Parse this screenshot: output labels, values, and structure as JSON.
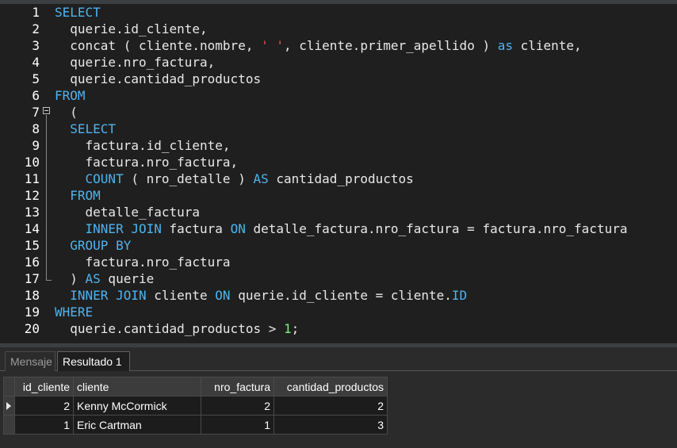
{
  "editor": {
    "line_numbers": [
      "1",
      "2",
      "3",
      "4",
      "5",
      "6",
      "7",
      "8",
      "9",
      "10",
      "11",
      "12",
      "13",
      "14",
      "15",
      "16",
      "17",
      "18",
      "19",
      "20"
    ],
    "lines": [
      [
        {
          "t": "SELECT",
          "c": "kw"
        }
      ],
      [
        {
          "t": "  querie.id_cliente,",
          "c": ""
        }
      ],
      [
        {
          "t": "  concat ( cliente.nombre, ",
          "c": ""
        },
        {
          "t": "' '",
          "c": "str"
        },
        {
          "t": ", cliente.primer_apellido ) ",
          "c": ""
        },
        {
          "t": "as",
          "c": "kw"
        },
        {
          "t": " cliente,",
          "c": ""
        }
      ],
      [
        {
          "t": "  querie.nro_factura,",
          "c": ""
        }
      ],
      [
        {
          "t": "  querie.cantidad_productos",
          "c": ""
        }
      ],
      [
        {
          "t": "FROM",
          "c": "kw"
        }
      ],
      [
        {
          "t": "  (",
          "c": ""
        }
      ],
      [
        {
          "t": "  ",
          "c": ""
        },
        {
          "t": "SELECT",
          "c": "kw"
        }
      ],
      [
        {
          "t": "    factura.id_cliente,",
          "c": ""
        }
      ],
      [
        {
          "t": "    factura.nro_factura,",
          "c": ""
        }
      ],
      [
        {
          "t": "    ",
          "c": ""
        },
        {
          "t": "COUNT",
          "c": "kw"
        },
        {
          "t": " ( nro_detalle ) ",
          "c": ""
        },
        {
          "t": "AS",
          "c": "kw"
        },
        {
          "t": " cantidad_productos",
          "c": ""
        }
      ],
      [
        {
          "t": "  ",
          "c": ""
        },
        {
          "t": "FROM",
          "c": "kw"
        }
      ],
      [
        {
          "t": "    detalle_factura",
          "c": ""
        }
      ],
      [
        {
          "t": "    ",
          "c": ""
        },
        {
          "t": "INNER JOIN",
          "c": "kw"
        },
        {
          "t": " factura ",
          "c": ""
        },
        {
          "t": "ON",
          "c": "kw"
        },
        {
          "t": " detalle_factura.nro_factura = factura.nro_factura",
          "c": ""
        }
      ],
      [
        {
          "t": "  ",
          "c": ""
        },
        {
          "t": "GROUP BY",
          "c": "kw"
        }
      ],
      [
        {
          "t": "    factura.nro_factura",
          "c": ""
        }
      ],
      [
        {
          "t": "  ) ",
          "c": ""
        },
        {
          "t": "AS",
          "c": "kw"
        },
        {
          "t": " querie",
          "c": ""
        }
      ],
      [
        {
          "t": "  ",
          "c": ""
        },
        {
          "t": "INNER JOIN",
          "c": "kw"
        },
        {
          "t": " cliente ",
          "c": ""
        },
        {
          "t": "ON",
          "c": "kw"
        },
        {
          "t": " querie.id_cliente = cliente.",
          "c": ""
        },
        {
          "t": "ID",
          "c": "kw"
        }
      ],
      [
        {
          "t": "WHERE",
          "c": "kw"
        }
      ],
      [
        {
          "t": "  querie.cantidad_productos > ",
          "c": ""
        },
        {
          "t": "1",
          "c": "num"
        },
        {
          "t": ";",
          "c": ""
        }
      ]
    ]
  },
  "tabs": {
    "messages_label": "Mensaje",
    "result_label": "Resultado 1"
  },
  "results": {
    "columns": [
      "id_cliente",
      "cliente",
      "nro_factura",
      "cantidad_productos"
    ],
    "rows": [
      [
        "2",
        "Kenny McCormick",
        "2",
        "2"
      ],
      [
        "1",
        "Eric Cartman",
        "1",
        "3"
      ]
    ]
  },
  "colors": {
    "keyword": "#4fb3f0",
    "string": "#f05050",
    "number": "#7ef07e",
    "editor_bg": "#1f1f1f"
  }
}
